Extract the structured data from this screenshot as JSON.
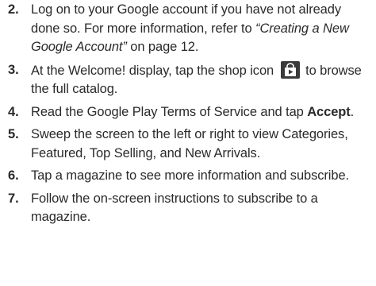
{
  "steps": [
    {
      "number": "2.",
      "text_before": "Log on to your Google account if you have not already done so. For more information, refer to ",
      "ref_title": "“Creating a New Google Account”",
      "text_after": " on page 12."
    },
    {
      "number": "3.",
      "text_before": "At the Welcome! display, tap the shop icon",
      "icon": "shop-icon",
      "text_after": "to browse the full catalog."
    },
    {
      "number": "4.",
      "text_before": "Read the Google Play Terms of Service and tap ",
      "bold": "Accept",
      "text_after": "."
    },
    {
      "number": "5.",
      "text": "Sweep the screen to the left or right to view Categories, Featured, Top Selling, and New Arrivals."
    },
    {
      "number": "6.",
      "text": "Tap a magazine to see more information and subscribe."
    },
    {
      "number": "7.",
      "text": "Follow the on-screen instructions to subscribe to a magazine."
    }
  ]
}
